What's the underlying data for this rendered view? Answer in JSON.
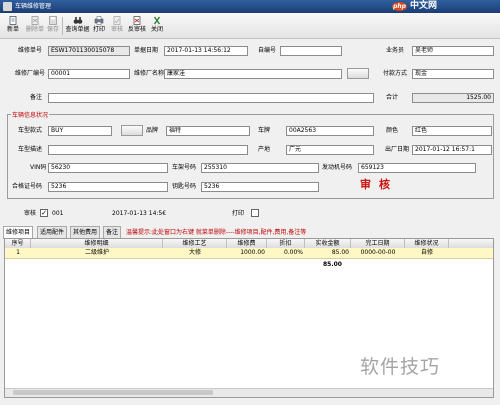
{
  "window": {
    "title": "车辆维修管理"
  },
  "watermark": {
    "site_badge": "php",
    "site_name": "中文网",
    "bottom_text": "软件技巧"
  },
  "toolbar": {
    "items": [
      {
        "label": "新单",
        "icon": "new-doc-icon",
        "enabled": true
      },
      {
        "label": "删除单",
        "icon": "delete-doc-icon",
        "enabled": false
      },
      {
        "label": "保存",
        "icon": "save-icon",
        "enabled": false
      },
      {
        "label": "查询单据",
        "icon": "binoculars-icon",
        "enabled": true
      },
      {
        "label": "打印",
        "icon": "printer-icon",
        "enabled": true
      },
      {
        "label": "审核",
        "icon": "audit-icon",
        "enabled": false
      },
      {
        "label": "反审核",
        "icon": "unaudit-icon",
        "enabled": true
      },
      {
        "label": "关闭",
        "icon": "close-icon",
        "enabled": true
      }
    ]
  },
  "form": {
    "repair_no_label": "维修单号",
    "repair_no": "ESW1701130015078",
    "doc_date_label": "单据日期",
    "doc_date": "2017-01-13 14:56:12",
    "self_no_label": "自编号",
    "self_no": "",
    "salesman_label": "业务员",
    "salesman": "吴老师",
    "factory_no_label": "维修厂编号",
    "factory_no": "00001",
    "factory_name_label": "维修厂名称",
    "factory_name": "康家洼",
    "payment_label": "付款方式",
    "payment": "现金",
    "remark_label": "备注",
    "remark": "",
    "total_label": "合计",
    "total": "1525.00"
  },
  "vehicle": {
    "group_title": "车辆信息状况",
    "model_label": "车型款式",
    "model": "BUY",
    "brand_label": "品牌",
    "brand": "福特",
    "plate_label": "车牌",
    "plate": "00A2563",
    "color_label": "颜色",
    "color": "红色",
    "desc_label": "车型描述",
    "desc": "",
    "origin_label": "产地",
    "origin": "广元",
    "factory_date_label": "出厂日期",
    "factory_date": "2017-01-12 16:57:1",
    "vin_label": "VIN码",
    "vin": "56230",
    "frame_label": "车架号码",
    "frame": "255310",
    "engine_label": "发动机号码",
    "engine": "659123",
    "cert_label": "合格证号码",
    "cert": "5236",
    "key_label": "钥匙号码",
    "key": "5236"
  },
  "audit": {
    "stamp": "审核",
    "audit_label": "审核",
    "audit_checked": true,
    "auditor": "001",
    "audit_time": "2017-01-13 14:5€",
    "print_label": "打印",
    "print_checked": false
  },
  "tabs": {
    "items": [
      "维修项目",
      "适用配件",
      "其他费用",
      "备注"
    ],
    "active": 0,
    "hint": "温馨提示:此处窗口为右键 就菜单删除----维修项目,配件,费用,备注等"
  },
  "grid": {
    "columns": [
      "序号",
      "维修明细",
      "维修工艺",
      "维修费",
      "折扣",
      "实收金额",
      "完工日期",
      "维修状况"
    ],
    "rows": [
      [
        "1",
        "二级维护",
        "大修",
        "1000.00",
        "0.00%",
        "85.00",
        "0000-00-00",
        "自修"
      ]
    ],
    "total": "85.00"
  }
}
